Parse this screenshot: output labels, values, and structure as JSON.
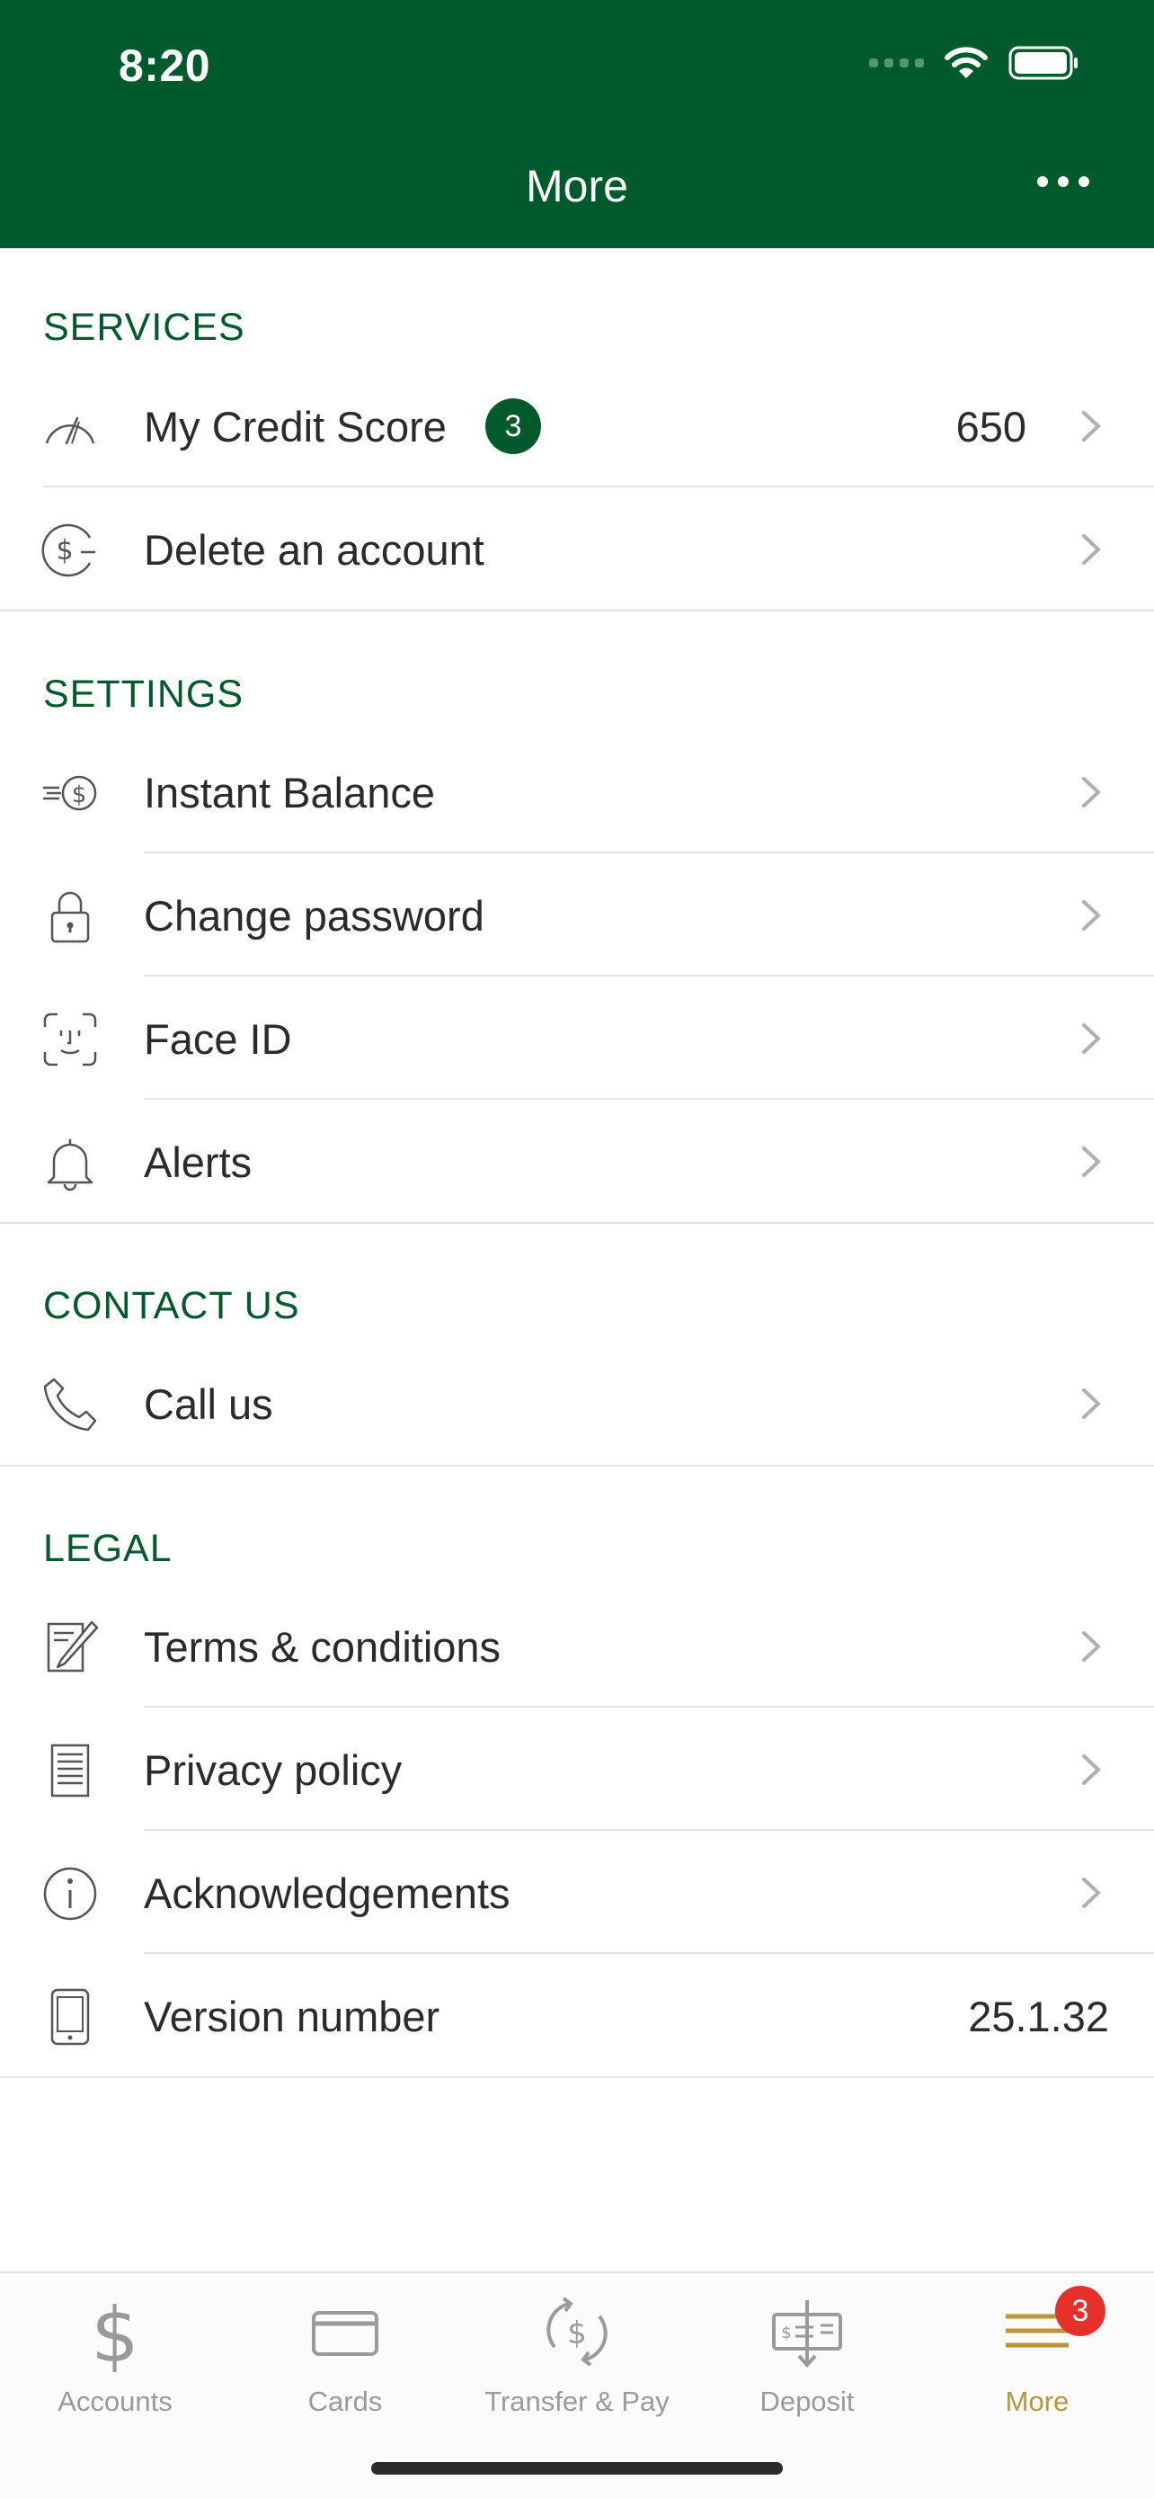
{
  "status_bar": {
    "time": "8:20"
  },
  "header": {
    "title": "More"
  },
  "sections": {
    "services": {
      "title": "SERVICES",
      "items": [
        {
          "label": "My Credit Score",
          "badge": "3",
          "value": "650",
          "icon": "gauge-icon"
        },
        {
          "label": "Delete an account",
          "icon": "dollar-minus-icon"
        }
      ]
    },
    "settings": {
      "title": "SETTINGS",
      "items": [
        {
          "label": "Instant Balance",
          "icon": "fast-dollar-icon"
        },
        {
          "label": "Change password",
          "icon": "lock-icon"
        },
        {
          "label": "Face ID",
          "icon": "face-id-icon"
        },
        {
          "label": "Alerts",
          "icon": "bell-icon"
        }
      ]
    },
    "contact": {
      "title": "CONTACT US",
      "items": [
        {
          "label": "Call us",
          "icon": "phone-icon"
        }
      ]
    },
    "legal": {
      "title": "LEGAL",
      "items": [
        {
          "label": "Terms & conditions",
          "icon": "document-pen-icon"
        },
        {
          "label": "Privacy policy",
          "icon": "document-lines-icon"
        },
        {
          "label": "Acknowledgements",
          "icon": "info-icon"
        },
        {
          "label": "Version number",
          "value": "25.1.32",
          "icon": "phone-device-icon"
        }
      ]
    }
  },
  "tabbar": {
    "items": [
      {
        "label": "Accounts",
        "icon": "dollar-sign-icon"
      },
      {
        "label": "Cards",
        "icon": "card-icon"
      },
      {
        "label": "Transfer & Pay",
        "icon": "transfer-icon"
      },
      {
        "label": "Deposit",
        "icon": "check-deposit-icon"
      },
      {
        "label": "More",
        "icon": "menu-icon",
        "badge": "3"
      }
    ]
  },
  "colors": {
    "brand_green": "#005a2b",
    "active_gold": "#b8963c",
    "badge_red": "#e8302b"
  }
}
